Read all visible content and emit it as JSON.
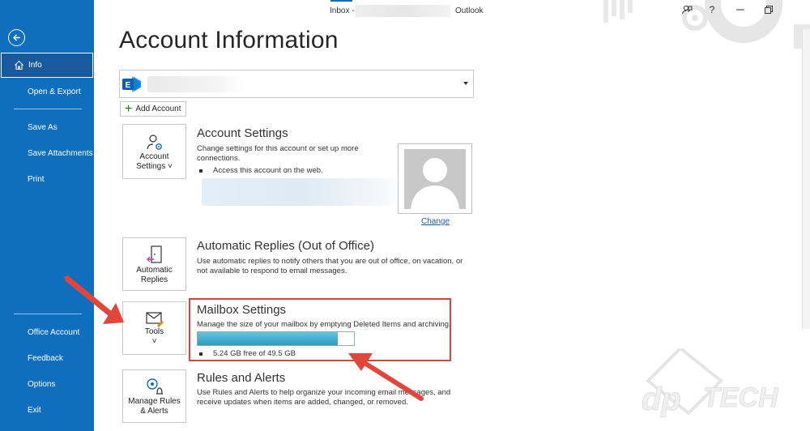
{
  "titlebar": {
    "inbox_prefix": "Inbox -",
    "app_name": "Outlook",
    "controls": [
      "feedback-icon",
      "help-icon",
      "minimize-icon",
      "restore-icon"
    ],
    "help_glyph": "?"
  },
  "sidebar": {
    "items": [
      {
        "label": "Info",
        "active": true
      },
      {
        "label": "Open & Export"
      },
      {
        "label": "Save As"
      },
      {
        "label": "Save Attachments"
      },
      {
        "label": "Print"
      },
      {
        "label": "Office Account"
      },
      {
        "label": "Feedback"
      },
      {
        "label": "Options"
      },
      {
        "label": "Exit"
      }
    ]
  },
  "main": {
    "page_title": "Account Information",
    "account_dropdown": {
      "logo_letter": "E"
    },
    "add_account_label": "Add Account",
    "sections": {
      "account_settings": {
        "tile_label_line1": "Account",
        "tile_label_line2": "Settings ˅",
        "title": "Account Settings",
        "description": "Change settings for this account or set up more connections.",
        "bullet": "Access this account on the web.",
        "change_link": "Change"
      },
      "automatic_replies": {
        "tile_label_line1": "Automatic",
        "tile_label_line2": "Replies",
        "title": "Automatic Replies (Out of Office)",
        "description": "Use automatic replies to notify others that you are out of office, on vacation, or not available to respond to email messages."
      },
      "mailbox_settings": {
        "tile_label_line1": "Tools",
        "tile_label_line2": "˅",
        "title": "Mailbox Settings",
        "description": "Manage the size of your mailbox by emptying Deleted Items and archiving.",
        "quota_text": "5.24 GB free of 49.5 GB",
        "quota_used_fraction": 0.894
      },
      "rules_alerts": {
        "tile_label_line1": "Manage Rules",
        "tile_label_line2": "& Alerts",
        "title": "Rules and Alerts",
        "description": "Use Rules and Alerts to help organize your incoming email messages, and receive updates when items are added, changed, or removed."
      }
    }
  },
  "colors": {
    "sidebar_bg": "#106ebe",
    "accent": "#106ebe",
    "highlight_red": "#d6453d",
    "quota_fill": "#2a9cc0",
    "link": "#1a5fa8"
  }
}
